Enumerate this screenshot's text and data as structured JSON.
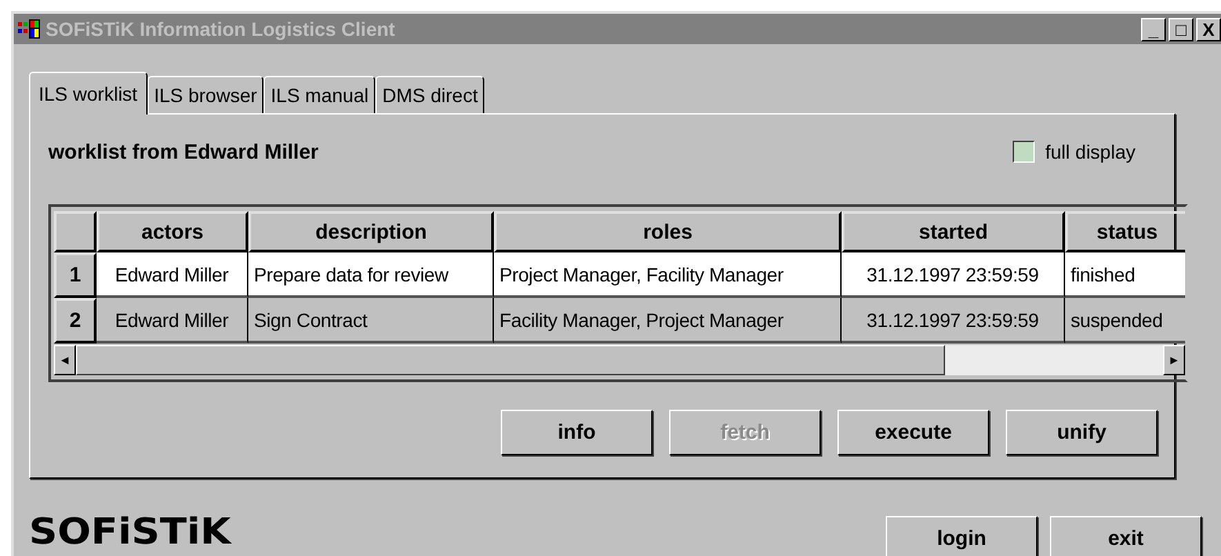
{
  "window": {
    "title": "SOFiSTiK Information Logistics Client",
    "controls": [
      "_",
      "□",
      "X"
    ]
  },
  "tabs": [
    {
      "label": "ILS worklist",
      "selected": true
    },
    {
      "label": "ILS browser",
      "selected": false
    },
    {
      "label": "ILS manual",
      "selected": false
    },
    {
      "label": "DMS direct",
      "selected": false
    }
  ],
  "heading": "worklist from Edward Miller",
  "full_display": {
    "label": "full display",
    "checked": false
  },
  "table": {
    "columns": [
      "actors",
      "description",
      "roles",
      "started",
      "status"
    ],
    "rows": [
      {
        "number": "1",
        "selected": true,
        "cells": [
          "Edward Miller",
          "Prepare data for review",
          "Project Manager, Facility Manager",
          "31.12.1997 23:59:59",
          "finished"
        ]
      },
      {
        "number": "2",
        "selected": false,
        "cells": [
          "Edward Miller",
          "Sign Contract",
          "Facility Manager, Project Manager",
          "31.12.1997 23:59:59",
          "suspended"
        ]
      }
    ],
    "scroll_left": "◄",
    "scroll_right": "►"
  },
  "actions": [
    {
      "label": "info",
      "disabled": false
    },
    {
      "label": "fetch",
      "disabled": true
    },
    {
      "label": "execute",
      "disabled": false
    },
    {
      "label": "unify",
      "disabled": false
    }
  ],
  "logo": "SOFiSTiK",
  "footer_buttons": [
    "login",
    "exit"
  ]
}
